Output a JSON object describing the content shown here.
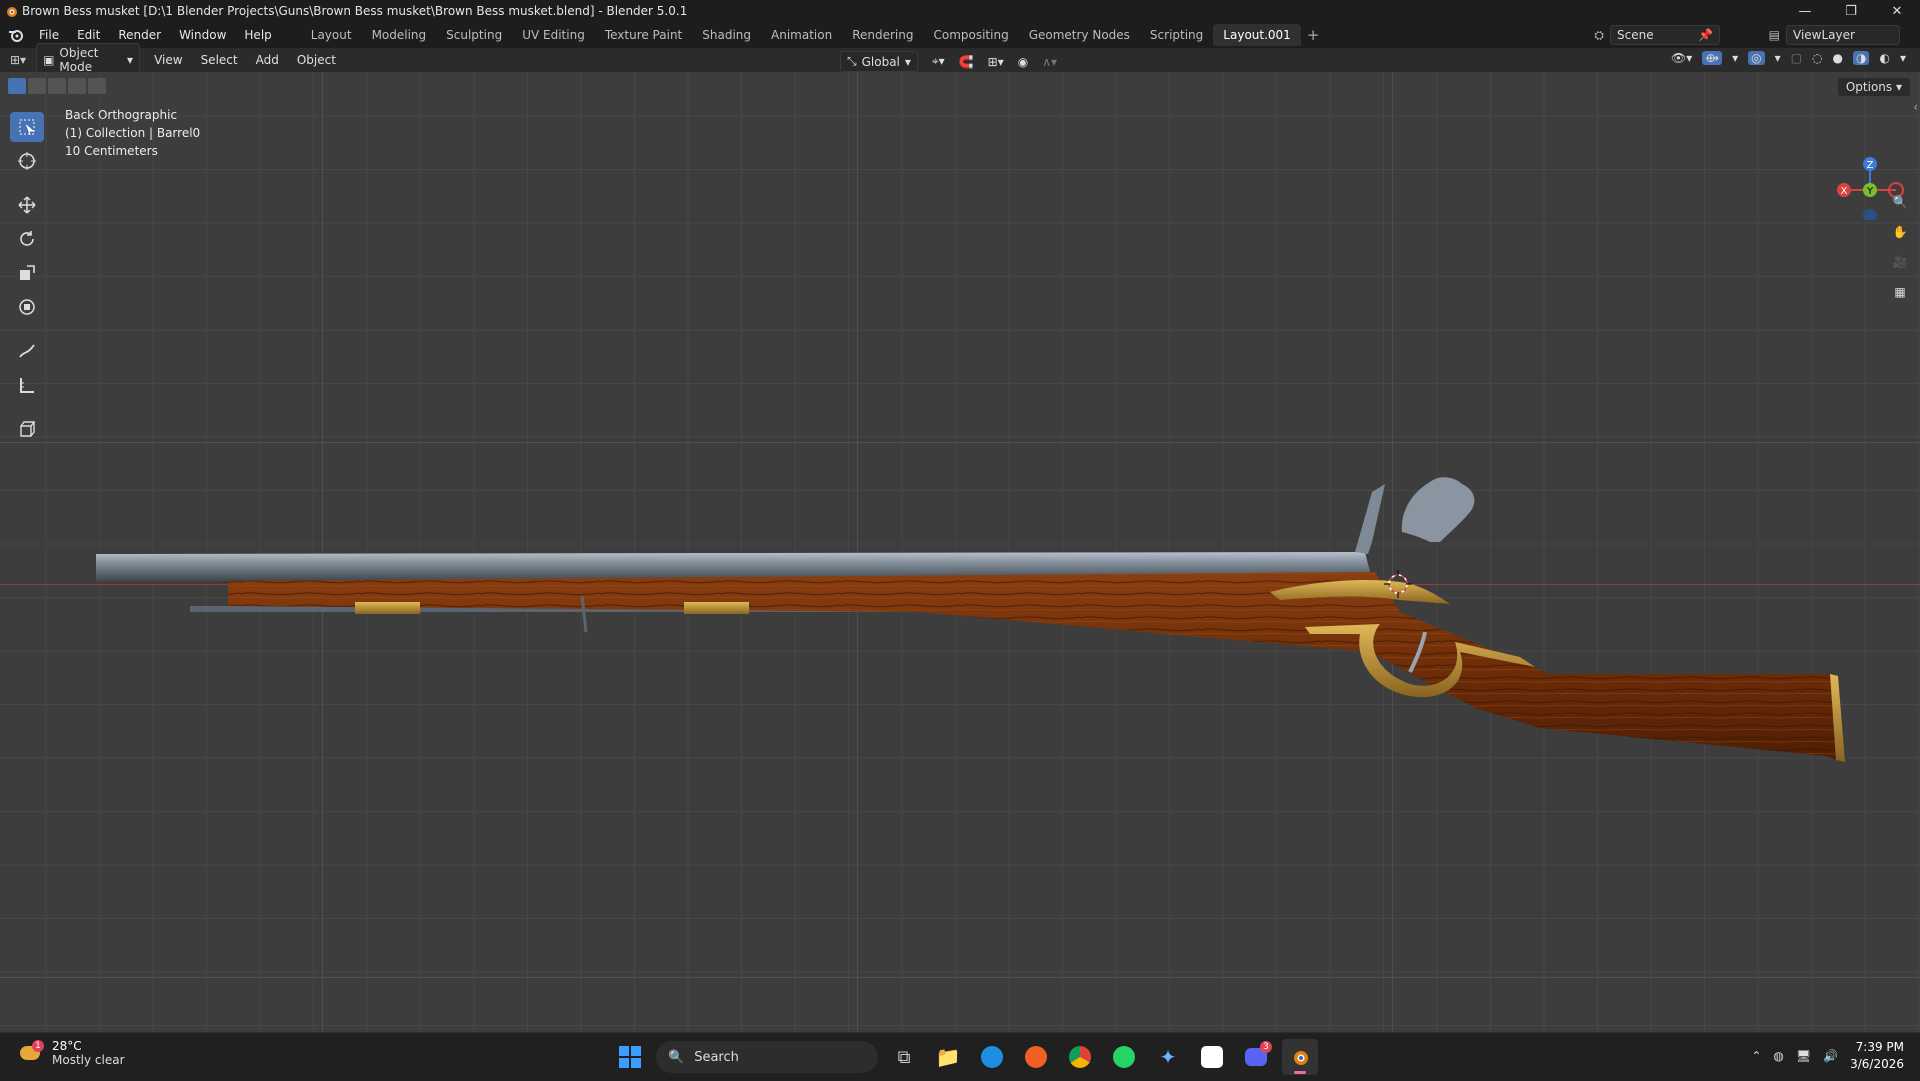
{
  "window": {
    "title": "Brown Bess musket [D:\\1 Blender Projects\\Guns\\Brown Bess musket\\Brown Bess musket.blend] - Blender 5.0.1",
    "minimize": "—",
    "maximize": "❐",
    "close": "✕"
  },
  "menu": {
    "items": [
      "File",
      "Edit",
      "Render",
      "Window",
      "Help"
    ],
    "workspaces": [
      "Layout",
      "Modeling",
      "Sculpting",
      "UV Editing",
      "Texture Paint",
      "Shading",
      "Animation",
      "Rendering",
      "Compositing",
      "Geometry Nodes",
      "Scripting",
      "Layout.001"
    ],
    "active_workspace": "Layout.001",
    "scene": "Scene",
    "view_layer": "ViewLayer"
  },
  "header": {
    "mode": "Object Mode",
    "menus": [
      "View",
      "Select",
      "Add",
      "Object"
    ],
    "transform_orientation": "Global"
  },
  "viewport": {
    "view_name": "Back Orthographic",
    "collection_info": "(1) Collection | Barrel0",
    "scale": "10 Centimeters",
    "options": "Options",
    "gizmo": {
      "z": "Z",
      "y": "Y",
      "x": "X"
    },
    "colors": {
      "bg": "#3d3d3d",
      "accent": "#4772b3",
      "x_axis": "#d9423f",
      "y_axis": "#7bbf2a",
      "z_axis": "#3d7bd9"
    }
  },
  "tools": [
    "select-box-icon",
    "cursor-icon",
    "move-icon",
    "rotate-icon",
    "scale-icon",
    "transform-icon",
    "annotate-icon",
    "measure-icon",
    "add-cube-icon"
  ],
  "taskbar": {
    "weather_temp": "28°C",
    "weather_cond": "Mostly clear",
    "weather_badge": "1",
    "search": "Search",
    "discord_badge": "3",
    "time": "7:39 PM",
    "date": "3/6/2026"
  }
}
